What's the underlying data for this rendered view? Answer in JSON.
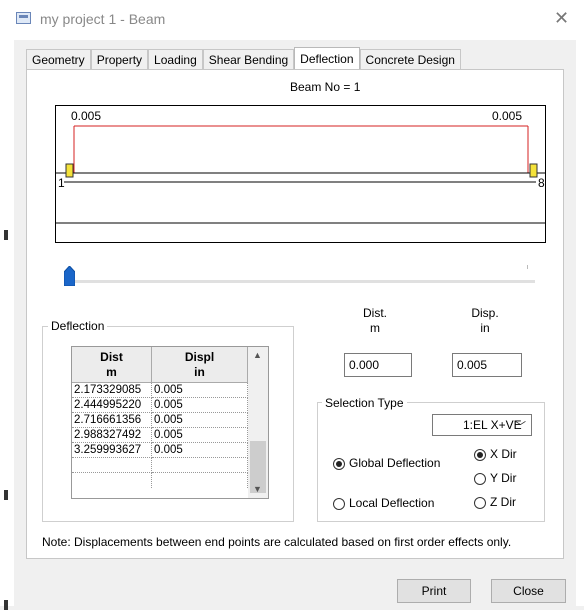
{
  "window": {
    "title": "my project 1 - Beam"
  },
  "tabs": [
    {
      "label": "Geometry",
      "active": false
    },
    {
      "label": "Property",
      "active": false
    },
    {
      "label": "Loading",
      "active": false
    },
    {
      "label": "Shear Bending",
      "active": false
    },
    {
      "label": "Deflection",
      "active": true
    },
    {
      "label": "Concrete Design",
      "active": false
    }
  ],
  "beam_no": "Beam No = 1",
  "diagram": {
    "left_value": "0.005",
    "right_value": "0.005",
    "start_node": "1",
    "end_node": "8",
    "line_color": "#d42020",
    "node_color": "#f4e23a"
  },
  "slider": {
    "position": 0
  },
  "deflection": {
    "group_title": "Deflection",
    "columns": [
      {
        "name": "Dist",
        "unit": "m"
      },
      {
        "name": "Displ",
        "unit": "in"
      }
    ],
    "rows": [
      [
        "2.173329085",
        "0.005"
      ],
      [
        "2.444995220",
        "0.005"
      ],
      [
        "2.716661356",
        "0.005"
      ],
      [
        "2.988327492",
        "0.005"
      ],
      [
        "3.259993627",
        "0.005"
      ],
      [
        "",
        ""
      ]
    ]
  },
  "dist_field": {
    "label": "Dist.",
    "unit": "m",
    "value": "0.000"
  },
  "disp_field": {
    "label": "Disp.",
    "unit": "in",
    "value": "0.005"
  },
  "selection": {
    "group_title": "Selection Type",
    "load_case": "1:EL X+VE",
    "global_label": "Global Deflection",
    "local_label": "Local Deflection",
    "global_selected": true,
    "x_label": "X Dir",
    "y_label": "Y Dir",
    "z_label": "Z Dir",
    "dir_selected": "X"
  },
  "note": "Note: Displacements between end points are calculated based on first order effects only.",
  "buttons": {
    "print": "Print",
    "close": "Close"
  }
}
